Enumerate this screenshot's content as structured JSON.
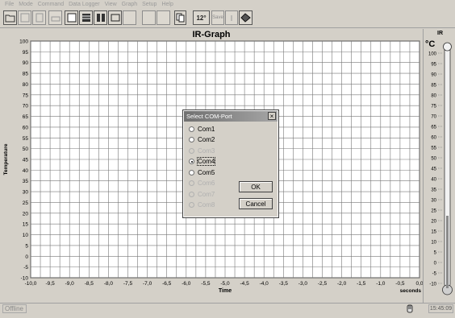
{
  "menu": [
    "File",
    "Mode",
    "Command",
    "Data Logger",
    "View",
    "Graph",
    "Setup",
    "Help"
  ],
  "toolbar": {
    "temp_button": "12°",
    "save_button": "Save"
  },
  "graph": {
    "title": "IR-Graph",
    "ylabel": "Temperature",
    "xlabel": "Time",
    "x_unit": "seconds",
    "y_ticks": [
      "100",
      "95",
      "90",
      "85",
      "80",
      "75",
      "70",
      "65",
      "60",
      "55",
      "50",
      "45",
      "40",
      "35",
      "30",
      "25",
      "20",
      "15",
      "10",
      "5",
      "0",
      "-5",
      "-10"
    ],
    "x_ticks": [
      "-10,0",
      "-9,5",
      "-9,0",
      "-8,5",
      "-8,0",
      "-7,5",
      "-7,0",
      "-6,5",
      "-6,0",
      "-5,5",
      "-5,0",
      "-4,5",
      "-4,0",
      "-3,5",
      "-3,0",
      "-2,5",
      "-2,0",
      "-1,5",
      "-1,0",
      "-0,5",
      "0,0"
    ]
  },
  "thermometer": {
    "header": "IR",
    "unit": "°C",
    "ticks": [
      "100",
      "95",
      "90",
      "85",
      "80",
      "75",
      "70",
      "65",
      "60",
      "55",
      "50",
      "45",
      "40",
      "35",
      "30",
      "25",
      "20",
      "15",
      "10",
      "5",
      "0",
      "-5",
      "-10"
    ]
  },
  "dialog": {
    "title": "Select COM-Port",
    "close": "×",
    "ports": [
      {
        "label": "Com1",
        "enabled": true,
        "checked": false
      },
      {
        "label": "Com2",
        "enabled": true,
        "checked": false
      },
      {
        "label": "Com3",
        "enabled": false,
        "checked": false
      },
      {
        "label": "Com4",
        "enabled": true,
        "checked": true
      },
      {
        "label": "Com5",
        "enabled": true,
        "checked": false
      },
      {
        "label": "Com6",
        "enabled": false,
        "checked": false
      },
      {
        "label": "Com7",
        "enabled": false,
        "checked": false
      },
      {
        "label": "Com8",
        "enabled": false,
        "checked": false
      }
    ],
    "ok_label": "OK",
    "cancel_label": "Cancel"
  },
  "status": {
    "left": "Offline",
    "time": "15:45:09"
  }
}
